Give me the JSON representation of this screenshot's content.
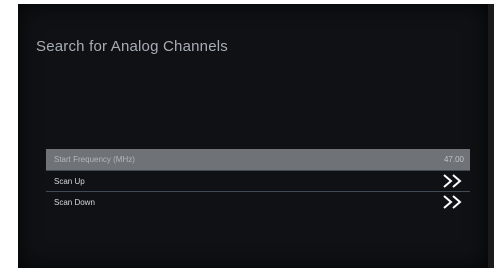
{
  "screen": {
    "title": "Search for Analog Channels"
  },
  "menu": {
    "items": [
      {
        "label": "Start Frequency (MHz)",
        "value": "47.00",
        "icon": ""
      },
      {
        "label": "Scan Up",
        "value": "",
        "icon": "double-chevron-right-icon"
      },
      {
        "label": "Scan Down",
        "value": "",
        "icon": "double-chevron-right-icon"
      }
    ],
    "selected_index": 0
  },
  "colors": {
    "background": "#0f1114",
    "selected_row": "#6f7378",
    "title_text": "#a7adb6",
    "divider": "#3e4b57"
  }
}
